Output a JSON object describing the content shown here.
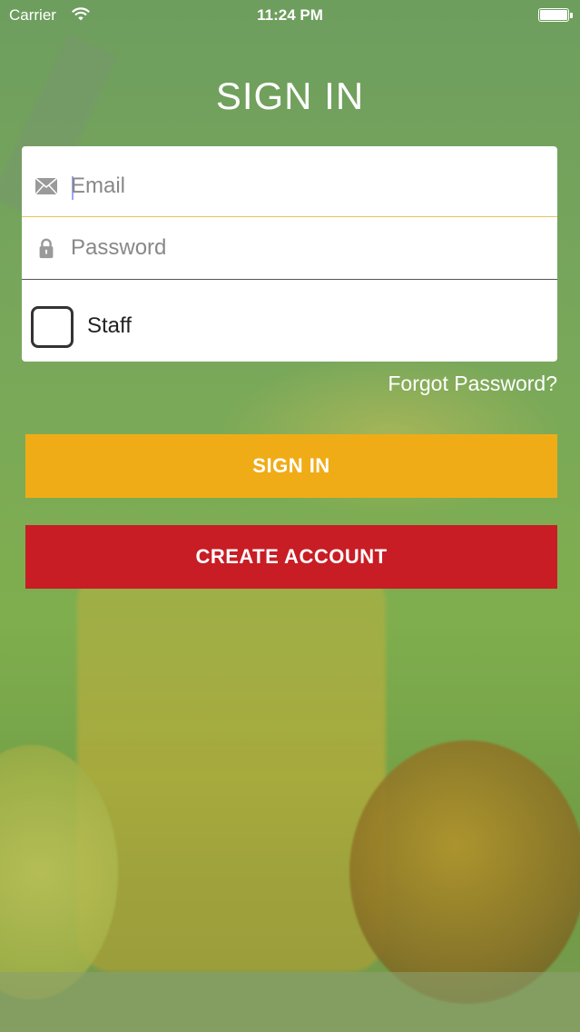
{
  "status_bar": {
    "carrier": "Carrier",
    "time": "11:24 PM",
    "battery_level": 1.0
  },
  "page": {
    "title": "SIGN IN"
  },
  "form": {
    "email": {
      "placeholder": "Email",
      "value": "",
      "icon": "envelope-icon"
    },
    "password": {
      "placeholder": "Password",
      "value": "",
      "icon": "lock-icon"
    },
    "staff": {
      "label": "Staff",
      "checked": false
    }
  },
  "links": {
    "forgot_password": "Forgot Password?"
  },
  "buttons": {
    "sign_in": "SIGN IN",
    "create_account": "CREATE ACCOUNT"
  },
  "colors": {
    "sign_in": "#f0ac17",
    "create_account": "#c81d25",
    "email_underline": "#e8c45a"
  }
}
